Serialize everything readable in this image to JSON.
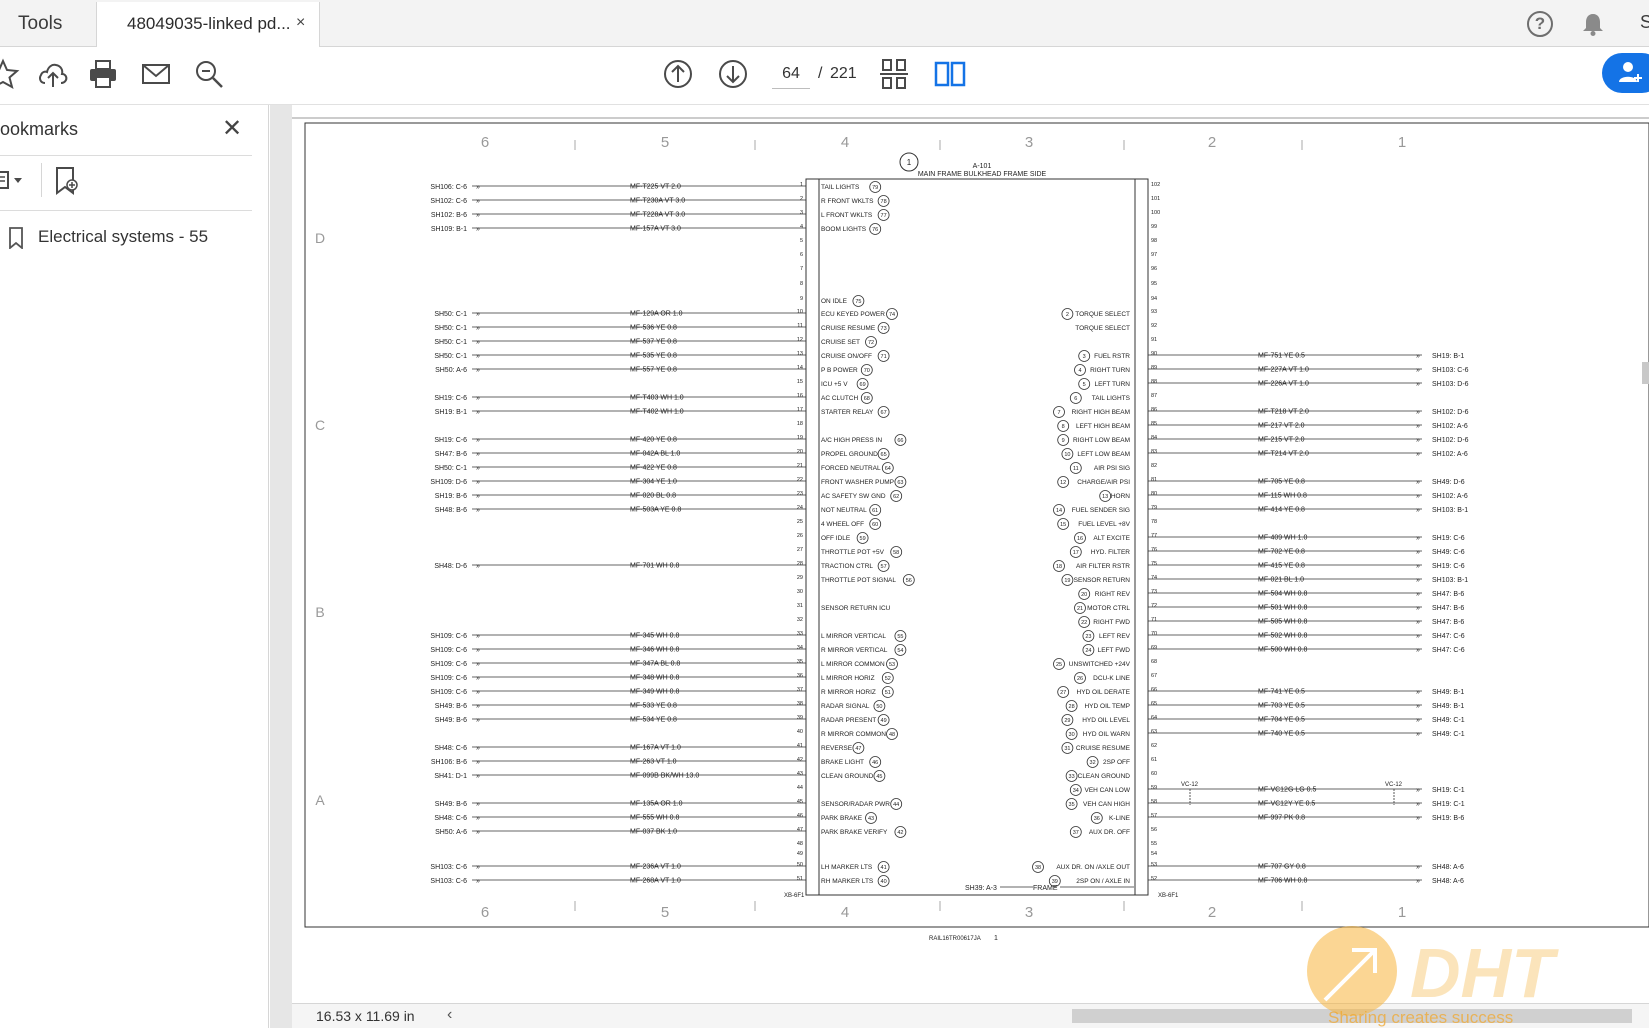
{
  "tabs": {
    "tools": "Tools",
    "document": "48049035-linked pd...",
    "close": "×"
  },
  "header": {
    "help": "?",
    "user_initial": "S"
  },
  "toolbar": {
    "current_page": "64",
    "separator": "/",
    "total_pages": "221"
  },
  "sidebar": {
    "title": "ookmarks",
    "close": "✕",
    "bookmark": "Electrical systems - 55"
  },
  "status": {
    "dimensions": "16.53 x 11.69 in",
    "nav_left": "‹"
  },
  "colors": {
    "accent": "#1473e6",
    "tab_bg": "#f3f3f3",
    "doc_bg": "#e6e6e6"
  },
  "schematic": {
    "col_labels": [
      "6",
      "5",
      "4",
      "3",
      "2",
      "1"
    ],
    "row_labels": [
      "D",
      "C",
      "B",
      "A"
    ],
    "connector_id": "A-101",
    "connector_title": "MAIN FRAME BULKHEAD FRAME SIDE",
    "connector_callout": "1",
    "xb_left": "XB-6F1",
    "xb_right": "XB-6F1",
    "frame_ref": "SH39: A-3",
    "frame_label": "FRAME",
    "footer_code": "RAIL16TR00617JA",
    "footer_page": "1",
    "vc_label_1": "VC-12",
    "vc_label_2": "VC-12",
    "left_wires": [
      {
        "ref": "SH106: C-6",
        "wire": "MF-T225  VT  2.0",
        "pin": "1",
        "label": "TAIL LIGHTS",
        "cir": "79"
      },
      {
        "ref": "SH102: C-6",
        "wire": "MF-T230A  VT  3.0",
        "pin": "2",
        "label": "R FRONT WKLTS",
        "cir": "78"
      },
      {
        "ref": "SH102: B-6",
        "wire": "MF-T228A  VT  3.0",
        "pin": "3",
        "label": "L FRONT WKLTS",
        "cir": "77"
      },
      {
        "ref": "SH109: B-1",
        "wire": "MF-157A  VT  3.0",
        "pin": "4",
        "label": "BOOM LIGHTS",
        "cir": "76"
      },
      {
        "ref": "",
        "wire": "",
        "pin": "9",
        "label": "ON IDLE",
        "cir": "75"
      },
      {
        "ref": "SH50: C-1",
        "wire": "MF-129A  OR  1.0",
        "pin": "10",
        "label": "ECU KEYED POWER",
        "cir": "74"
      },
      {
        "ref": "SH50: C-1",
        "wire": "MF-536  YE  0.8",
        "pin": "11",
        "label": "CRUISE RESUME",
        "cir": "73"
      },
      {
        "ref": "SH50: C-1",
        "wire": "MF-537  YE  0.8",
        "pin": "12",
        "label": "CRUISE SET",
        "cir": "72"
      },
      {
        "ref": "SH50: C-1",
        "wire": "MF-535  YE  0.8",
        "pin": "13",
        "label": "CRUISE ON/OFF",
        "cir": "71"
      },
      {
        "ref": "SH50: A-6",
        "wire": "MF-557  YE  0.8",
        "pin": "14",
        "label": "P B POWER",
        "cir": "70"
      },
      {
        "ref": "",
        "wire": "",
        "pin": "15",
        "label": "ICU +5 V",
        "cir": "69"
      },
      {
        "ref": "SH19: C-6",
        "wire": "MF-T403  WH  1.0",
        "pin": "16",
        "label": "AC CLUTCH",
        "cir": "68"
      },
      {
        "ref": "SH19: B-1",
        "wire": "MF-T402  WH  1.0",
        "pin": "17",
        "label": "STARTER RELAY",
        "cir": "67"
      },
      {
        "ref": "SH19: C-6",
        "wire": "MF-420  YE  0.8",
        "pin": "19",
        "label": "A/C HIGH PRESS IN",
        "cir": "66"
      },
      {
        "ref": "SH47: B-6",
        "wire": "MF-042A  BL  1.0",
        "pin": "20",
        "label": "PROPEL GROUND",
        "cir": "65"
      },
      {
        "ref": "SH50: C-1",
        "wire": "MF-422  YE  0.8",
        "pin": "21",
        "label": "FORCED NEUTRAL",
        "cir": "64"
      },
      {
        "ref": "SH109: D-6",
        "wire": "MF-304  YE  1.0",
        "pin": "22",
        "label": "FRONT WASHER PUMP",
        "cir": "63"
      },
      {
        "ref": "SH19: B-6",
        "wire": "MF-020  BL  0.8",
        "pin": "23",
        "label": "AC SAFETY SW GND",
        "cir": "62"
      },
      {
        "ref": "SH48: B-6",
        "wire": "MF-503A  YE  0.8",
        "pin": "24",
        "label": "NOT NEUTRAL",
        "cir": "61"
      },
      {
        "ref": "",
        "wire": "",
        "pin": "25",
        "label": "4 WHEEL OFF",
        "cir": "60"
      },
      {
        "ref": "",
        "wire": "",
        "pin": "26",
        "label": "OFF IDLE",
        "cir": "59"
      },
      {
        "ref": "",
        "wire": "",
        "pin": "27",
        "label": "THROTTLE POT +5V",
        "cir": "58"
      },
      {
        "ref": "SH48: D-6",
        "wire": "MF-701  WH  0.8",
        "pin": "28",
        "label": "TRACTION CTRL",
        "cir": "57"
      },
      {
        "ref": "",
        "wire": "",
        "pin": "29",
        "label": "THROTTLE POT SIGNAL",
        "cir": "56"
      },
      {
        "ref": "",
        "wire": "",
        "pin": "31",
        "label": "SENSOR RETURN ICU",
        "cir": ""
      },
      {
        "ref": "SH109: C-6",
        "wire": "MF-345  WH  0.8",
        "pin": "33",
        "label": "L MIRROR VERTICAL",
        "cir": "55"
      },
      {
        "ref": "SH109: C-6",
        "wire": "MF-346  WH  0.8",
        "pin": "34",
        "label": "R MIRROR VERTICAL",
        "cir": "54"
      },
      {
        "ref": "SH109: C-6",
        "wire": "MF-347A  BL  0.8",
        "pin": "35",
        "label": "L MIRROR COMMON",
        "cir": "53"
      },
      {
        "ref": "SH109: C-6",
        "wire": "MF-348  WH  0.8",
        "pin": "36",
        "label": "L MIRROR HORIZ",
        "cir": "52"
      },
      {
        "ref": "SH109: C-6",
        "wire": "MF-349  WH  0.8",
        "pin": "37",
        "label": "R MIRROR HORIZ",
        "cir": "51"
      },
      {
        "ref": "SH49: B-6",
        "wire": "MF-533  YE  0.8",
        "pin": "38",
        "label": "RADAR SIGNAL",
        "cir": "50"
      },
      {
        "ref": "SH49: B-6",
        "wire": "MF-534  YE  0.8",
        "pin": "39",
        "label": "RADAR PRESENT",
        "cir": "49"
      },
      {
        "ref": "",
        "wire": "",
        "pin": "40",
        "label": "R MIRROR COMMON",
        "cir": "48"
      },
      {
        "ref": "SH48: C-6",
        "wire": "MF-167A  VT  1.0",
        "pin": "41",
        "label": "REVERSE",
        "cir": "47"
      },
      {
        "ref": "SH106: B-6",
        "wire": "MF-263  VT  1.0",
        "pin": "42",
        "label": "BRAKE LIGHT",
        "cir": "46"
      },
      {
        "ref": "SH41: D-1",
        "wire": "MF-099B  BK/WH  13.0",
        "pin": "43",
        "label": "CLEAN GROUND",
        "cir": "45"
      },
      {
        "ref": "SH49: B-6",
        "wire": "MF-135A  OR  1.0",
        "pin": "45",
        "label": "SENSOR/RADAR PWR",
        "cir": "44"
      },
      {
        "ref": "SH48: C-6",
        "wire": "MF-555  WH  0.8",
        "pin": "46",
        "label": "PARK BRAKE",
        "cir": "43"
      },
      {
        "ref": "SH50: A-6",
        "wire": "MF-037  BK  1.0",
        "pin": "47",
        "label": "PARK BRAKE VERIFY",
        "cir": "42"
      },
      {
        "ref": "SH103: C-6",
        "wire": "MF-236A  VT  1.0",
        "pin": "50",
        "label": "LH MARKER LTS",
        "cir": "41"
      },
      {
        "ref": "SH103: C-6",
        "wire": "MF-268A  VT  1.0",
        "pin": "51",
        "label": "RH MARKER LTS",
        "cir": "40"
      }
    ],
    "right_wires": [
      {
        "pin": "102",
        "label": "",
        "cir": "",
        "wire": "",
        "ref": ""
      },
      {
        "pin": "93",
        "label": "TORQUE SELECT",
        "cir": "2",
        "wire": "",
        "ref": ""
      },
      {
        "pin": "92",
        "label": "TORQUE SELECT",
        "cir": "",
        "wire": "",
        "ref": ""
      },
      {
        "pin": "90",
        "label": "FUEL RSTR",
        "cir": "3",
        "wire": "MF-751  YE  0.5",
        "ref": "SH19: B-1"
      },
      {
        "pin": "89",
        "label": "RIGHT TURN",
        "cir": "4",
        "wire": "MF-227A  VT  1.0",
        "ref": "SH103: C-6"
      },
      {
        "pin": "88",
        "label": "LEFT TURN",
        "cir": "5",
        "wire": "MF-226A  VT  1.0",
        "ref": "SH103: D-6"
      },
      {
        "pin": "87",
        "label": "TAIL LIGHTS",
        "cir": "6",
        "wire": "",
        "ref": ""
      },
      {
        "pin": "86",
        "label": "RIGHT HIGH BEAM",
        "cir": "7",
        "wire": "MF-T218  VT  2.0",
        "ref": "SH102: D-6"
      },
      {
        "pin": "85",
        "label": "LEFT HIGH BEAM",
        "cir": "8",
        "wire": "MF-217  VT  2.0",
        "ref": "SH102: A-6"
      },
      {
        "pin": "84",
        "label": "RIGHT LOW BEAM",
        "cir": "9",
        "wire": "MF-215  VT  2.0",
        "ref": "SH102: D-6"
      },
      {
        "pin": "83",
        "label": "LEFT LOW BEAM",
        "cir": "10",
        "wire": "MF-T214  VT  2.0",
        "ref": "SH102: A-6"
      },
      {
        "pin": "82",
        "label": "AIR PSI SIG",
        "cir": "11",
        "wire": "",
        "ref": ""
      },
      {
        "pin": "81",
        "label": "CHARGE/AIR PSI",
        "cir": "12",
        "wire": "MF-705  YE  0.8",
        "ref": "SH49: D-6"
      },
      {
        "pin": "80",
        "label": "HORN",
        "cir": "13",
        "wire": "MF-115  WH  0.8",
        "ref": "SH102: A-6"
      },
      {
        "pin": "79",
        "label": "FUEL SENDER SIG",
        "cir": "14",
        "wire": "MF-414  YE  0.8",
        "ref": "SH103: B-1"
      },
      {
        "pin": "78",
        "label": "FUEL LEVEL +8V",
        "cir": "15",
        "wire": "",
        "ref": ""
      },
      {
        "pin": "77",
        "label": "ALT EXCITE",
        "cir": "16",
        "wire": "MF-409  WH  1.0",
        "ref": "SH19: C-6"
      },
      {
        "pin": "76",
        "label": "HYD. FILTER",
        "cir": "17",
        "wire": "MF-702  YE  0.8",
        "ref": "SH49: C-6"
      },
      {
        "pin": "75",
        "label": "AIR FILTER RSTR",
        "cir": "18",
        "wire": "MF-415  YE  0.8",
        "ref": "SH19: C-6"
      },
      {
        "pin": "74",
        "label": "SENSOR RETURN",
        "cir": "19",
        "wire": "MF-021  BL  1.0",
        "ref": "SH103: B-1"
      },
      {
        "pin": "73",
        "label": "RIGHT REV",
        "cir": "20",
        "wire": "MF-504  WH  0.8",
        "ref": "SH47: B-6"
      },
      {
        "pin": "72",
        "label": "MOTOR CTRL",
        "cir": "21",
        "wire": "MF-501  WH  0.8",
        "ref": "SH47: B-6"
      },
      {
        "pin": "71",
        "label": "RIGHT FWD",
        "cir": "22",
        "wire": "MF-505  WH  0.8",
        "ref": "SH47: B-6"
      },
      {
        "pin": "70",
        "label": "LEFT REV",
        "cir": "23",
        "wire": "MF-502  WH  0.8",
        "ref": "SH47: C-6"
      },
      {
        "pin": "69",
        "label": "LEFT FWD",
        "cir": "24",
        "wire": "MF-500  WH  0.8",
        "ref": "SH47: C-6"
      },
      {
        "pin": "68",
        "label": "UNSWITCHED +24V",
        "cir": "25",
        "wire": "",
        "ref": ""
      },
      {
        "pin": "67",
        "label": "DCU-K LINE",
        "cir": "26",
        "wire": "",
        "ref": ""
      },
      {
        "pin": "66",
        "label": "HYD OIL DERATE",
        "cir": "27",
        "wire": "MF-741  YE  0.5",
        "ref": "SH49: B-1"
      },
      {
        "pin": "65",
        "label": "HYD OIL TEMP",
        "cir": "28",
        "wire": "MF-703  YE  0.5",
        "ref": "SH49: B-1"
      },
      {
        "pin": "64",
        "label": "HYD OIL LEVEL",
        "cir": "29",
        "wire": "MF-704  YE  0.5",
        "ref": "SH49: C-1"
      },
      {
        "pin": "63",
        "label": "HYD OIL WARN",
        "cir": "30",
        "wire": "MF-740  YE  0.5",
        "ref": "SH49: C-1"
      },
      {
        "pin": "62",
        "label": "CRUISE RESUME",
        "cir": "31",
        "wire": "",
        "ref": ""
      },
      {
        "pin": "61",
        "label": "2SP OFF",
        "cir": "32",
        "wire": "",
        "ref": ""
      },
      {
        "pin": "60",
        "label": "CLEAN GROUND",
        "cir": "33",
        "wire": "",
        "ref": ""
      },
      {
        "pin": "59",
        "label": "VEH CAN LOW",
        "cir": "34",
        "wire": "MF-VC12G  LG  0.5",
        "ref": "SH19: C-1"
      },
      {
        "pin": "58",
        "label": "VEH CAN HIGH",
        "cir": "35",
        "wire": "MF-VC12Y  YE  0.5",
        "ref": "SH19: C-1"
      },
      {
        "pin": "57",
        "label": "K-LINE",
        "cir": "36",
        "wire": "MF-997  PK  0.8",
        "ref": "SH19: B-6"
      },
      {
        "pin": "56",
        "label": "AUX DR. OFF",
        "cir": "37",
        "wire": "",
        "ref": ""
      },
      {
        "pin": "53",
        "label": "AUX DR. ON /AXLE OUT",
        "cir": "38",
        "wire": "MF-707  GY  0.8",
        "ref": "SH48: A-6"
      },
      {
        "pin": "52",
        "label": "2SP ON / AXLE IN",
        "cir": "39",
        "wire": "MF-706  WH  0.8",
        "ref": "SH48: A-6"
      }
    ]
  },
  "watermark": {
    "text": "Sharing creates success"
  }
}
